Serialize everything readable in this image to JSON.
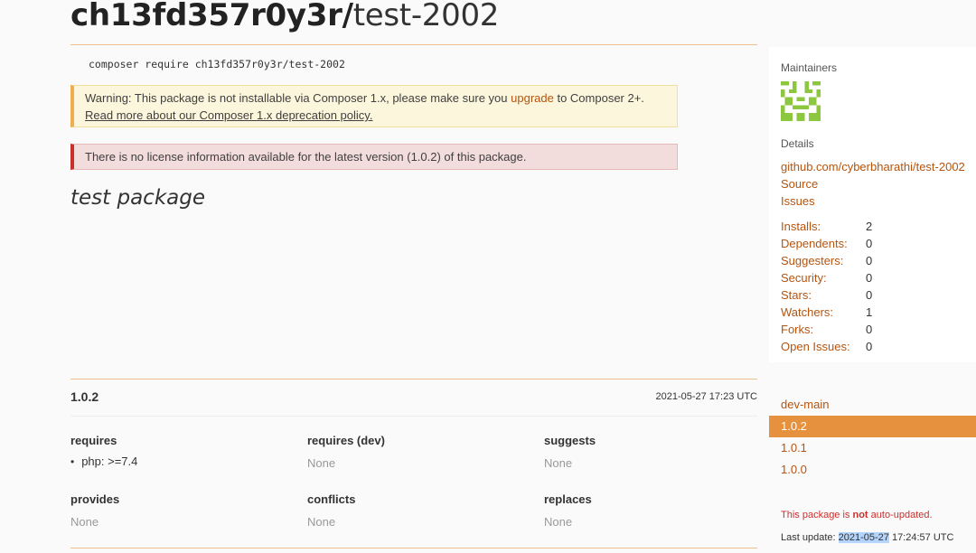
{
  "package": {
    "vendor": "ch13fd357r0y3r/",
    "name": "test-2002",
    "composer_command": "composer require ch13fd357r0y3r/test-2002",
    "description": "test package"
  },
  "alerts": {
    "warning_prefix": "Warning: This package is not installable via Composer 1.x, please make sure you ",
    "warning_link": "upgrade",
    "warning_suffix": " to Composer 2+.",
    "warning_readmore": "Read more about our Composer 1.x deprecation policy.",
    "license": "There is no license information available for the latest version (1.0.2) of this package."
  },
  "version": {
    "name": "1.0.2",
    "date": "2021-05-27 17:23 UTC",
    "requires_title": "requires",
    "requires_item": "php: >=7.4",
    "requires_dev_title": "requires (dev)",
    "requires_dev_value": "None",
    "suggests_title": "suggests",
    "suggests_value": "None",
    "provides_title": "provides",
    "provides_value": "None",
    "conflicts_title": "conflicts",
    "conflicts_value": "None",
    "replaces_title": "replaces",
    "replaces_value": "None"
  },
  "sidebar": {
    "maintainers_label": "Maintainers",
    "details_label": "Details",
    "repo_link": "github.com/cyberbharathi/test-2002",
    "source_link": "Source",
    "issues_link": "Issues",
    "stats": [
      {
        "label": "Installs:",
        "value": "2"
      },
      {
        "label": "Dependents:",
        "value": "0"
      },
      {
        "label": "Suggesters:",
        "value": "0"
      },
      {
        "label": "Security:",
        "value": "0"
      },
      {
        "label": "Stars:",
        "value": "0"
      },
      {
        "label": "Watchers:",
        "value": "1"
      },
      {
        "label": "Forks:",
        "value": "0"
      },
      {
        "label": "Open Issues:",
        "value": "0"
      }
    ],
    "versions": [
      "dev-main",
      "1.0.2",
      "1.0.1",
      "1.0.0"
    ],
    "active_version": "1.0.2",
    "notice_prefix": "This package is ",
    "notice_bold": "not",
    "notice_suffix": " auto-updated.",
    "last_update_label": "Last update: ",
    "last_update_date": "2021-05-27",
    "last_update_time": " 17:24:57 UTC"
  },
  "colors": {
    "accent": "#b5540f",
    "active_version_bg": "#e6913d",
    "warning_border": "#f0ad4e",
    "danger_border": "#c9302c",
    "avatar": "#8dc63f"
  },
  "icons": {
    "maintainer_avatar": "identicon-avatar"
  }
}
